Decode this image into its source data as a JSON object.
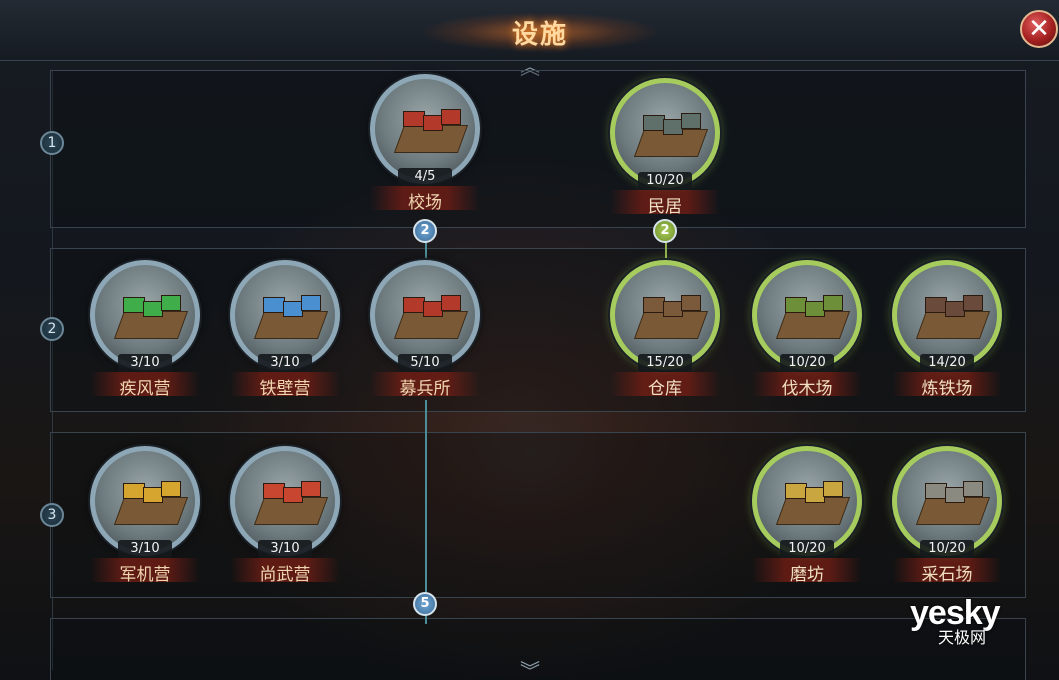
{
  "title": "设施",
  "close_label": "✕",
  "scroll_up": "︽",
  "scroll_down": "︾",
  "rows": [
    {
      "number": "1"
    },
    {
      "number": "2"
    },
    {
      "number": "3"
    }
  ],
  "connectors": [
    {
      "label": "2",
      "color": "blue"
    },
    {
      "label": "2",
      "color": "green"
    },
    {
      "label": "5",
      "color": "blue"
    }
  ],
  "facilities": [
    {
      "name": "校场",
      "level": "4/5",
      "frame": "blue",
      "tint": "#b33a2a"
    },
    {
      "name": "民居",
      "level": "10/20",
      "frame": "green",
      "tint": "#5f6f6a"
    },
    {
      "name": "疾风营",
      "level": "3/10",
      "frame": "blue",
      "tint": "#3fae4a"
    },
    {
      "name": "铁壁营",
      "level": "3/10",
      "frame": "blue",
      "tint": "#4a8fd0"
    },
    {
      "name": "募兵所",
      "level": "5/10",
      "frame": "blue",
      "tint": "#b33a2a"
    },
    {
      "name": "仓库",
      "level": "15/20",
      "frame": "green",
      "tint": "#7a5a3a"
    },
    {
      "name": "伐木场",
      "level": "10/20",
      "frame": "green",
      "tint": "#6d8f3a"
    },
    {
      "name": "炼铁场",
      "level": "14/20",
      "frame": "green",
      "tint": "#6a4a3a"
    },
    {
      "name": "军机营",
      "level": "3/10",
      "frame": "blue",
      "tint": "#d6a530"
    },
    {
      "name": "尚武营",
      "level": "3/10",
      "frame": "blue",
      "tint": "#c8452f"
    },
    {
      "name": "磨坊",
      "level": "10/20",
      "frame": "green",
      "tint": "#c9a640"
    },
    {
      "name": "采石场",
      "level": "10/20",
      "frame": "green",
      "tint": "#8a8a80"
    }
  ],
  "watermark": {
    "main": "yesky",
    "sub": "天极网"
  }
}
